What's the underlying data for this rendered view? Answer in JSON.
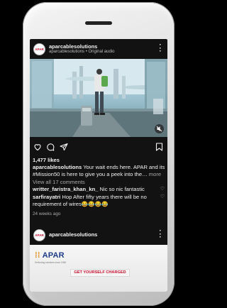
{
  "post": {
    "username": "aparcablesolutions",
    "subtitle": "aparcablesolutions • Original audio",
    "avatar_text": "APAR",
    "likes": "1,477 likes",
    "caption_user": "aparcablesolutions",
    "caption_line1": " Your wait ends here. APAR and its",
    "caption_line2": "#Mission50 is here to give you a peek into the…",
    "caption_more": " more",
    "view_comments": "View all 17 comments",
    "comments": [
      {
        "user": "writter_faristra_khan_kn_",
        "text": " Nic so nic fantastic"
      },
      {
        "user": "sarfirayatri",
        "text": " Hop After fifty years there will be no"
      },
      {
        "user": "",
        "text": "requirement of wires😂😂😂😂"
      }
    ],
    "time_ago": "24 weeks ago",
    "icons": [
      "heart-icon",
      "comment-icon",
      "share-icon",
      "bookmark-icon",
      "more-icon",
      "mute-icon"
    ]
  },
  "post2": {
    "username": "aparcablesolutions",
    "avatar_text": "APAR",
    "brand": "APAR",
    "brand_tag": "Delivering solutions since 1958",
    "cta": "GET YOURSELF CHARGED"
  }
}
